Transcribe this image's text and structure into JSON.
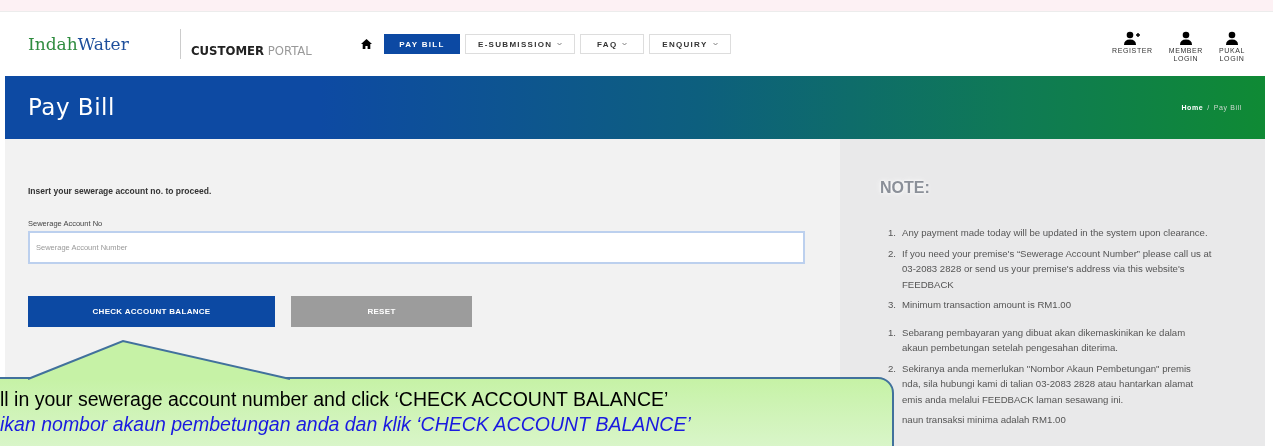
{
  "header": {
    "logo": {
      "first": "Indah",
      "second": "Water"
    },
    "portal": {
      "bold": "CUSTOMER",
      "light": "PORTAL"
    },
    "nav": [
      {
        "label": "PAY BILL",
        "selected": true,
        "dropdown": false
      },
      {
        "label": "E-SUBMISSION",
        "selected": false,
        "dropdown": true
      },
      {
        "label": "FAQ",
        "selected": false,
        "dropdown": true
      },
      {
        "label": "ENQUIRY",
        "selected": false,
        "dropdown": true
      }
    ],
    "accounts": [
      {
        "kind": "register",
        "lines": [
          "REGISTER"
        ]
      },
      {
        "kind": "login",
        "lines": [
          "MEMBER",
          "LOGIN"
        ]
      },
      {
        "kind": "login",
        "lines": [
          "PUKAL",
          "LOGIN"
        ]
      }
    ]
  },
  "banner": {
    "title": "Pay Bill",
    "breadcrumb": [
      {
        "label": "Home",
        "current": false
      },
      {
        "label": "Pay Bill",
        "current": true
      }
    ],
    "separator": "/"
  },
  "form": {
    "instruction": "Insert your sewerage account no. to proceed.",
    "field": {
      "label": "Sewerage Account No",
      "placeholder": "Sewerage Account Number"
    },
    "buttons": [
      {
        "label": "CHECK ACCOUNT BALANCE",
        "kind": "primary"
      },
      {
        "label": "RESET",
        "kind": "secondary"
      }
    ]
  },
  "note": {
    "title": "NOTE:",
    "groups": [
      [
        {
          "number": "1.",
          "lines": [
            "Any payment made today will be updated in the system upon clearance."
          ]
        },
        {
          "number": "2.",
          "lines": [
            "If you need your premise's “Sewerage Account Number” please call us at",
            "03-2083 2828 or send us your premise's address via this website's",
            "FEEDBACK"
          ]
        },
        {
          "number": "3.",
          "lines": [
            "Minimum transaction amount is RM1.00"
          ]
        }
      ],
      [
        {
          "number": "1.",
          "lines": [
            "Sebarang pembayaran yang dibuat akan dikemaskinikan ke dalam",
            "akaun pembetungan setelah pengesahan diterima."
          ]
        },
        {
          "number": "2.",
          "lines": [
            "Sekiranya anda memerlukan \"Nombor Akaun Pembetungan\" premis",
            "nda, sila hubungi kami di talian 03-2083 2828 atau hantarkan alamat",
            "emis anda melalui FEEDBACK laman sesawang ini."
          ]
        },
        {
          "lines": [
            "naun transaksi minima adalah RM1.00"
          ]
        }
      ]
    ]
  },
  "callout": {
    "lines": [
      {
        "text": "ll in your sewerage account number and click ‘CHECK ACCOUNT BALANCE’",
        "kind": "english"
      },
      {
        "text": "ikan nombor akaun pembetungan anda dan klik ‘CHECK ACCOUNT BALANCE’",
        "kind": "malay"
      }
    ]
  }
}
